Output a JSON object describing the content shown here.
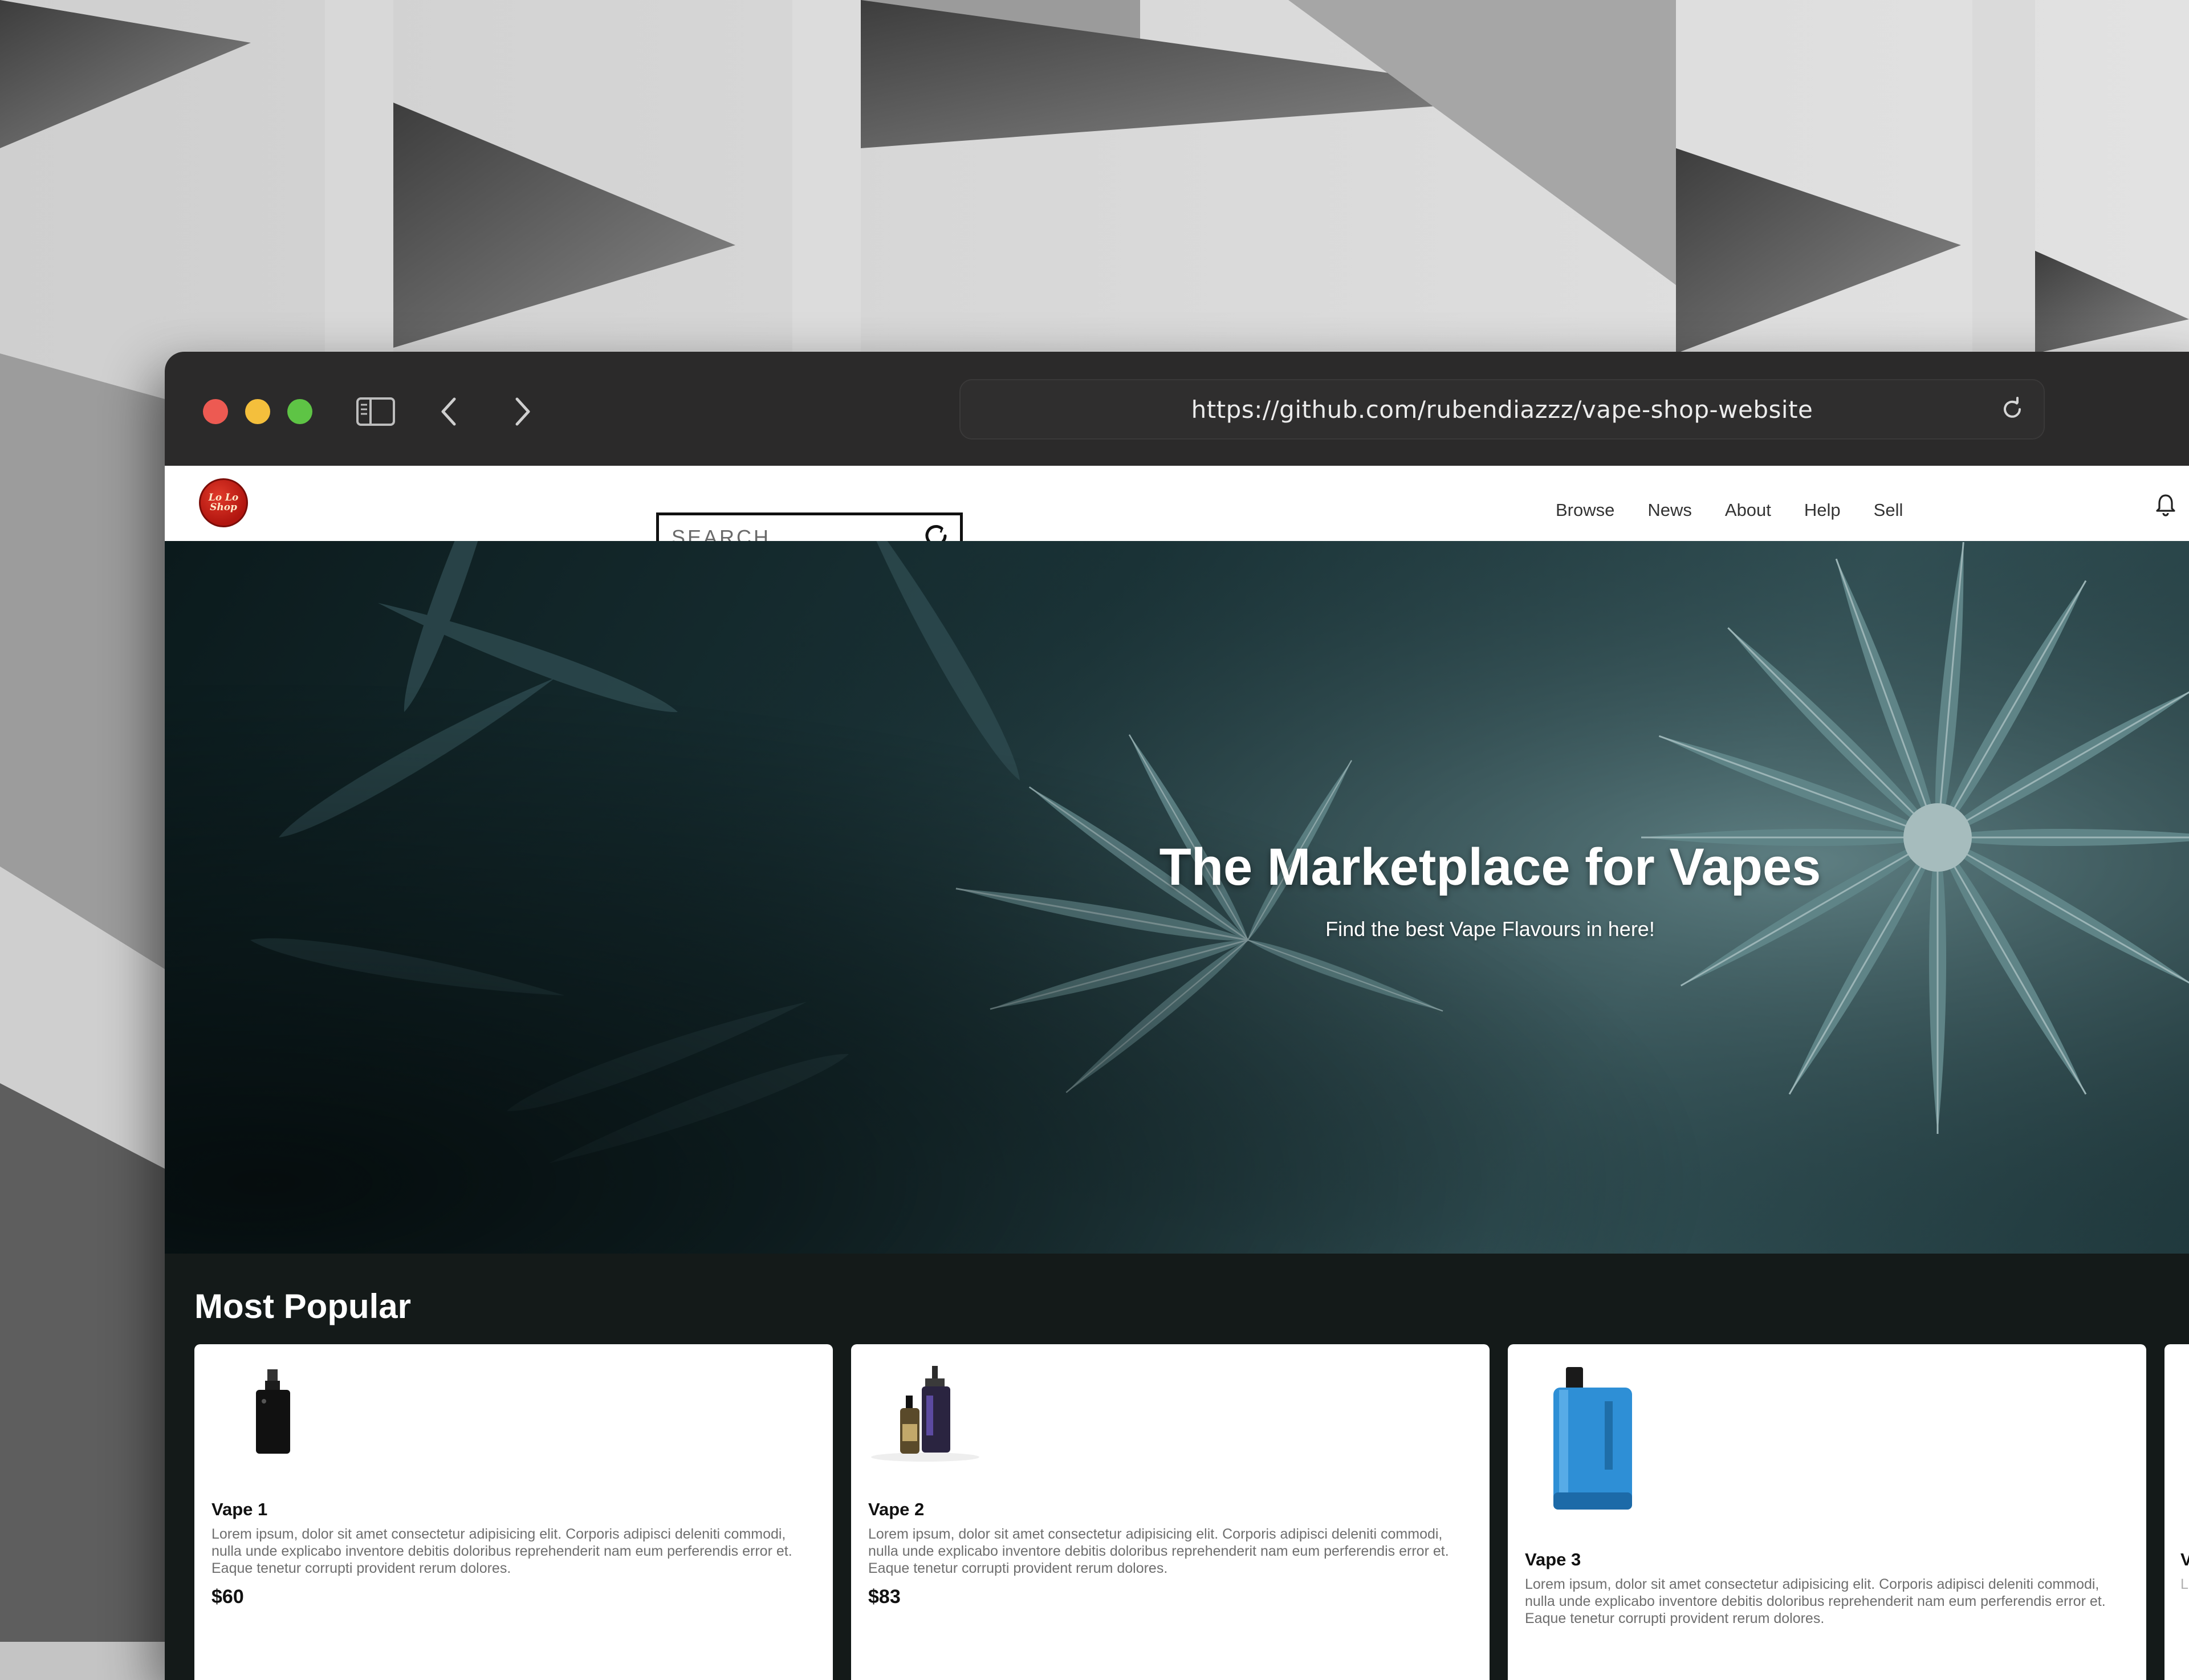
{
  "browser": {
    "url": "https://github.com/rubendiazzz/vape-shop-website",
    "traffic_lights": {
      "close": "#ed5a52",
      "minimize": "#f4bf3c",
      "maximize": "#5ec445"
    }
  },
  "site": {
    "logo": {
      "line1": "Lo Lo",
      "line2": "Shop"
    },
    "search": {
      "placeholder": "SEARCH..."
    },
    "nav": [
      "Browse",
      "News",
      "About",
      "Help",
      "Sell"
    ]
  },
  "hero": {
    "title": "The Marketplace for Vapes",
    "subtitle": "Find the best Vape Flavours in here!"
  },
  "popular": {
    "title": "Most Popular",
    "products": [
      {
        "name": "Vape 1",
        "description": "Lorem ipsum, dolor sit amet consectetur adipisicing elit. Corporis adipisci deleniti commodi, nulla unde explicabo inventore debitis doloribus reprehenderit nam eum perferendis error et. Eaque tenetur corrupti provident rerum dolores.",
        "price": "$60",
        "image": "black-box-mod-vape"
      },
      {
        "name": "Vape 2",
        "description": "Lorem ipsum, dolor sit amet consectetur adipisicing elit. Corporis adipisci deleniti commodi, nulla unde explicabo inventore debitis doloribus reprehenderit nam eum perferendis error et. Eaque tenetur corrupti provident rerum dolores.",
        "price": "$83",
        "image": "purple-mod-with-eliquid-bottle"
      },
      {
        "name": "Vape 3",
        "description": "Lorem ipsum, dolor sit amet consectetur adipisicing elit. Corporis adipisci deleniti commodi, nulla unde explicabo inventore debitis doloribus reprehenderit nam eum perferendis error et. Eaque tenetur corrupti provident rerum dolores.",
        "image": "blue-disposable-vape"
      }
    ],
    "partial_card": {
      "initial": "V",
      "text_start": "L"
    }
  }
}
